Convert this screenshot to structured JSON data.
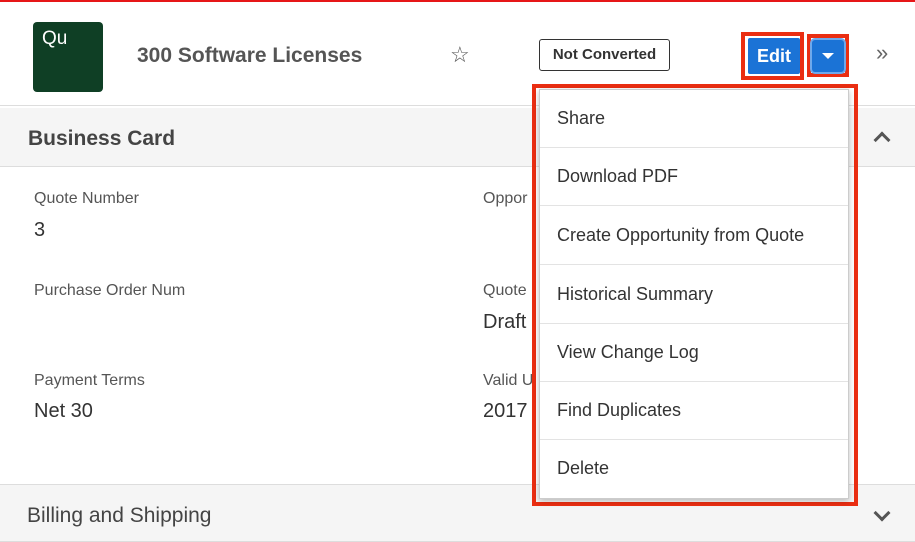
{
  "header": {
    "avatar_text": "Qu",
    "record_title": "300 Software Licenses",
    "status": "Not Converted",
    "edit_label": "Edit"
  },
  "sections": {
    "business_card": "Business Card",
    "billing_shipping": "Billing and Shipping"
  },
  "fields": {
    "quote_number": {
      "label": "Quote Number",
      "value": "3"
    },
    "opportunity": {
      "label": "Oppor",
      "value": ""
    },
    "purchase_order": {
      "label": "Purchase Order Num",
      "value": ""
    },
    "quote_stage": {
      "label": "Quote",
      "value": "Draft"
    },
    "payment_terms": {
      "label": "Payment Terms",
      "value": "Net 30"
    },
    "valid_until": {
      "label": "Valid U",
      "value": "2017"
    }
  },
  "dropdown_menu": {
    "items": [
      "Share",
      "Download PDF",
      "Create Opportunity from Quote",
      "Historical Summary",
      "View Change Log",
      "Find Duplicates",
      "Delete"
    ]
  },
  "colors": {
    "accent_blue": "#1b73d6",
    "highlight_red": "#ea2e12",
    "avatar_green": "#0f3f25"
  }
}
